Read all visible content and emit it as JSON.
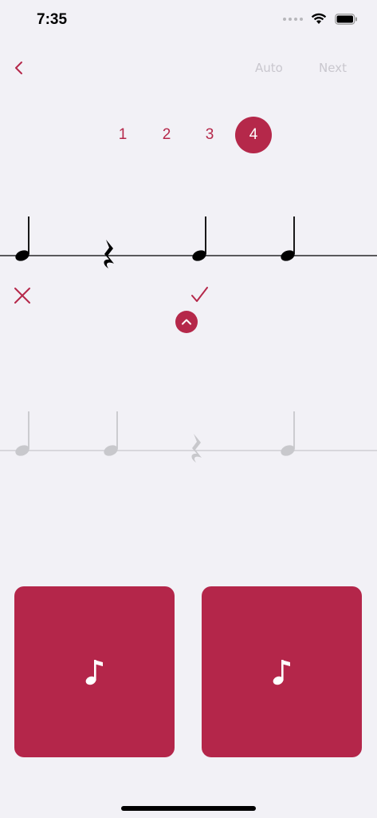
{
  "status_bar": {
    "time": "7:35"
  },
  "nav": {
    "back_icon": "chevron-left-icon",
    "auto_label": "Auto",
    "next_label": "Next"
  },
  "page_tabs": [
    {
      "label": "1",
      "active": false
    },
    {
      "label": "2",
      "active": false
    },
    {
      "label": "3",
      "active": false
    },
    {
      "label": "4",
      "active": true
    }
  ],
  "rhythm_answer": [
    "quarter-note",
    "quarter-rest",
    "quarter-note",
    "quarter-note"
  ],
  "rhythm_reference": [
    "quarter-note",
    "quarter-note",
    "quarter-rest",
    "quarter-note"
  ],
  "marks": {
    "wrong_icon": "x-mark-icon",
    "correct_icon": "check-mark-icon"
  },
  "answer_cards": [
    {
      "icon": "music-note-icon"
    },
    {
      "icon": "music-note-icon"
    }
  ],
  "colors": {
    "accent": "#b5284a",
    "background": "#f2f1f6",
    "inactive_text": "#c9c7ce",
    "staff_dark": "#000000",
    "staff_faded": "#c8c8cc"
  }
}
